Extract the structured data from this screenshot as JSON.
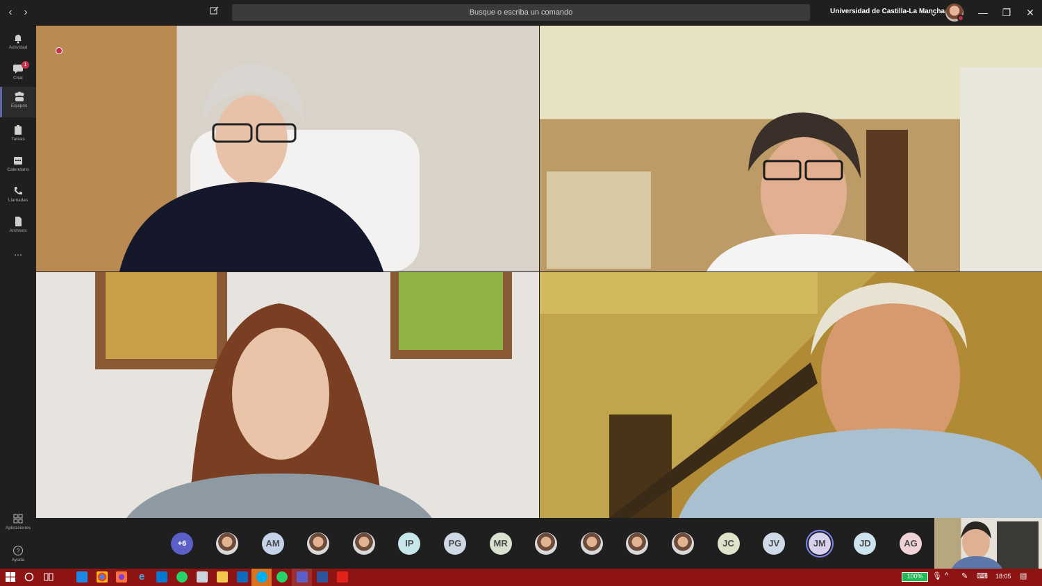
{
  "titlebar": {
    "search_placeholder": "Busque o escriba un comando",
    "organization": "Universidad de Castilla-La Mancha",
    "back_icon": "chevron-left-icon",
    "forward_icon": "chevron-right-icon",
    "compose_icon": "compose-icon"
  },
  "rail": {
    "items": [
      {
        "label": "Actividad",
        "icon": "bell-icon"
      },
      {
        "label": "Chat",
        "icon": "chat-icon",
        "badge": "1"
      },
      {
        "label": "Equipos",
        "icon": "teams-icon",
        "active": true
      },
      {
        "label": "Tareas",
        "icon": "assignments-icon"
      },
      {
        "label": "Calendario",
        "icon": "calendar-icon"
      },
      {
        "label": "Llamadas",
        "icon": "phone-icon"
      },
      {
        "label": "Archivos",
        "icon": "files-icon"
      }
    ],
    "more": "...",
    "apps_label": "Aplicaciones",
    "help_label": "Ayuda"
  },
  "participants": {
    "overflow": "+6",
    "avatars": [
      {
        "type": "photo"
      },
      {
        "initials": "AM",
        "color": "#c5d3e8"
      },
      {
        "type": "photo"
      },
      {
        "type": "photo"
      },
      {
        "initials": "IP",
        "color": "#c7e7ea"
      },
      {
        "initials": "PG",
        "color": "#cfd9e6"
      },
      {
        "initials": "MR",
        "color": "#d8e2cf"
      },
      {
        "type": "photo"
      },
      {
        "type": "photo"
      },
      {
        "type": "photo"
      },
      {
        "type": "photo"
      },
      {
        "initials": "JC",
        "color": "#dfe3c9"
      },
      {
        "initials": "JV",
        "color": "#cfdbe8"
      },
      {
        "initials": "JM",
        "color": "#d8d2ee",
        "selected": true
      },
      {
        "initials": "JD",
        "color": "#cde3ee"
      },
      {
        "initials": "AG",
        "color": "#f0d3d6"
      }
    ]
  },
  "taskbar": {
    "battery": "100%",
    "time": "18:05"
  },
  "colors": {
    "accent": "#6264a7",
    "recording": "#c4314b",
    "taskbar": "#8e1313"
  }
}
